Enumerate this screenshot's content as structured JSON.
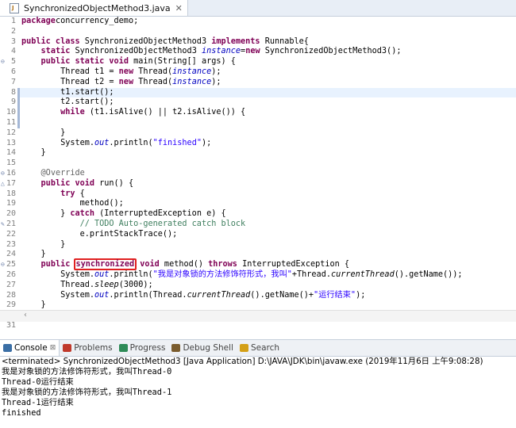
{
  "editor_tab": {
    "title": "SynchronizedObjectMethod3.java",
    "close": "✕"
  },
  "code": {
    "lines": [
      {
        "n": "1",
        "parts": [
          [
            "kw",
            "package"
          ],
          [
            "",
            "concurrency_demo;"
          ]
        ]
      },
      {
        "n": "2",
        "parts": []
      },
      {
        "n": "3",
        "parts": [
          [
            "kw",
            "public class"
          ],
          [
            "",
            " SynchronizedObjectMethod3 "
          ],
          [
            "kw",
            "implements"
          ],
          [
            "",
            " Runnable{"
          ]
        ]
      },
      {
        "n": "4",
        "parts": [
          [
            "",
            "    "
          ],
          [
            "kw",
            "static"
          ],
          [
            "",
            " SynchronizedObjectMethod3 "
          ],
          [
            "fld",
            "instance"
          ],
          [
            "",
            "="
          ],
          [
            "kw",
            "new"
          ],
          [
            "",
            " SynchronizedObjectMethod3();"
          ]
        ]
      },
      {
        "n": "5",
        "fold": "⊖",
        "parts": [
          [
            "",
            "    "
          ],
          [
            "kw",
            "public static void"
          ],
          [
            "",
            " main(String[] args) {"
          ]
        ]
      },
      {
        "n": "6",
        "parts": [
          [
            "",
            "        Thread t1 = "
          ],
          [
            "kw",
            "new"
          ],
          [
            "",
            " Thread("
          ],
          [
            "fld",
            "instance"
          ],
          [
            "",
            ");"
          ]
        ]
      },
      {
        "n": "7",
        "parts": [
          [
            "",
            "        Thread t2 = "
          ],
          [
            "kw",
            "new"
          ],
          [
            "",
            " Thread("
          ],
          [
            "fld",
            "instance"
          ],
          [
            "",
            ");"
          ]
        ]
      },
      {
        "n": "8",
        "hl": true,
        "parts": [
          [
            "",
            "        t1.start();"
          ]
        ]
      },
      {
        "n": "9",
        "parts": [
          [
            "",
            "        t2.start();"
          ]
        ]
      },
      {
        "n": "10",
        "parts": [
          [
            "",
            "        "
          ],
          [
            "kw",
            "while"
          ],
          [
            "",
            " (t1.isAlive() || t2.isAlive()) {"
          ]
        ]
      },
      {
        "n": "11",
        "parts": []
      },
      {
        "n": "12",
        "parts": [
          [
            "",
            "        }"
          ]
        ]
      },
      {
        "n": "13",
        "parts": [
          [
            "",
            "        System."
          ],
          [
            "fld",
            "out"
          ],
          [
            "",
            ".println("
          ],
          [
            "str",
            "\"finished\""
          ],
          [
            "",
            ");"
          ]
        ]
      },
      {
        "n": "14",
        "parts": [
          [
            "",
            "    }"
          ]
        ]
      },
      {
        "n": "15",
        "parts": []
      },
      {
        "n": "16",
        "fold": "⊖",
        "parts": [
          [
            "",
            "    "
          ],
          [
            "ann",
            "@Override"
          ]
        ]
      },
      {
        "n": "17",
        "fold": "△",
        "parts": [
          [
            "",
            "    "
          ],
          [
            "kw",
            "public void"
          ],
          [
            "",
            " run() {"
          ]
        ]
      },
      {
        "n": "18",
        "parts": [
          [
            "",
            "        "
          ],
          [
            "kw",
            "try"
          ],
          [
            "",
            " {"
          ]
        ]
      },
      {
        "n": "19",
        "parts": [
          [
            "",
            "            method();"
          ]
        ]
      },
      {
        "n": "20",
        "parts": [
          [
            "",
            "        } "
          ],
          [
            "kw",
            "catch"
          ],
          [
            "",
            " (InterruptedException e) {"
          ]
        ]
      },
      {
        "n": "21",
        "fold": "✎",
        "parts": [
          [
            "",
            "            "
          ],
          [
            "cmt",
            "// TODO Auto-generated catch block"
          ]
        ]
      },
      {
        "n": "22",
        "parts": [
          [
            "",
            "            e.printStackTrace();"
          ]
        ]
      },
      {
        "n": "23",
        "parts": [
          [
            "",
            "        }"
          ]
        ]
      },
      {
        "n": "24",
        "parts": [
          [
            "",
            "    }"
          ]
        ]
      },
      {
        "n": "25",
        "fold": "⊖",
        "parts": [
          [
            "",
            "    "
          ],
          [
            "kw",
            "public"
          ],
          [
            "",
            " "
          ],
          [
            "box",
            "synchronized"
          ],
          [
            "",
            " "
          ],
          [
            "kw",
            "void"
          ],
          [
            "",
            " method() "
          ],
          [
            "kw",
            "throws"
          ],
          [
            "",
            " InterruptedException {"
          ]
        ]
      },
      {
        "n": "26",
        "parts": [
          [
            "",
            "        System."
          ],
          [
            "fld",
            "out"
          ],
          [
            "",
            ".println("
          ],
          [
            "str",
            "\"我是对象锁的方法修饰符形式，我叫\""
          ],
          [
            "",
            "+Thread."
          ],
          [
            "mth",
            "currentThread"
          ],
          [
            "",
            "().getName());"
          ]
        ]
      },
      {
        "n": "27",
        "parts": [
          [
            "",
            "        Thread."
          ],
          [
            "mth",
            "sleep"
          ],
          [
            "",
            "(3000);"
          ]
        ]
      },
      {
        "n": "28",
        "parts": [
          [
            "",
            "        System."
          ],
          [
            "fld",
            "out"
          ],
          [
            "",
            ".println(Thread."
          ],
          [
            "mth",
            "currentThread"
          ],
          [
            "",
            "().getName()+"
          ],
          [
            "str",
            "\"运行结束\""
          ],
          [
            "",
            ");"
          ]
        ]
      },
      {
        "n": "29",
        "parts": [
          [
            "",
            "    }"
          ]
        ]
      },
      {
        "n": "30",
        "parts": [
          [
            "",
            "}"
          ]
        ]
      },
      {
        "n": "31",
        "parts": []
      }
    ]
  },
  "console_tabs": [
    {
      "label": "Console",
      "suffix": "⊠",
      "active": true,
      "icon": "console-icon",
      "color": "#3a6ea5"
    },
    {
      "label": "Problems",
      "icon": "problems-icon",
      "color": "#c0392b"
    },
    {
      "label": "Progress",
      "icon": "progress-icon",
      "color": "#2e8b57"
    },
    {
      "label": "Debug Shell",
      "icon": "debug-shell-icon",
      "color": "#7a5c2e"
    },
    {
      "label": "Search",
      "icon": "search-icon",
      "color": "#d4a017"
    }
  ],
  "console": {
    "header": "<terminated> SynchronizedObjectMethod3 [Java Application] D:\\JAVA\\JDK\\bin\\javaw.exe (2019年11月6日 上午9:08:28)",
    "output": [
      "我是对象锁的方法修饰符形式，我叫Thread-0",
      "Thread-0运行结束",
      "我是对象锁的方法修饰符形式，我叫Thread-1",
      "Thread-1运行结束",
      "finished"
    ]
  }
}
